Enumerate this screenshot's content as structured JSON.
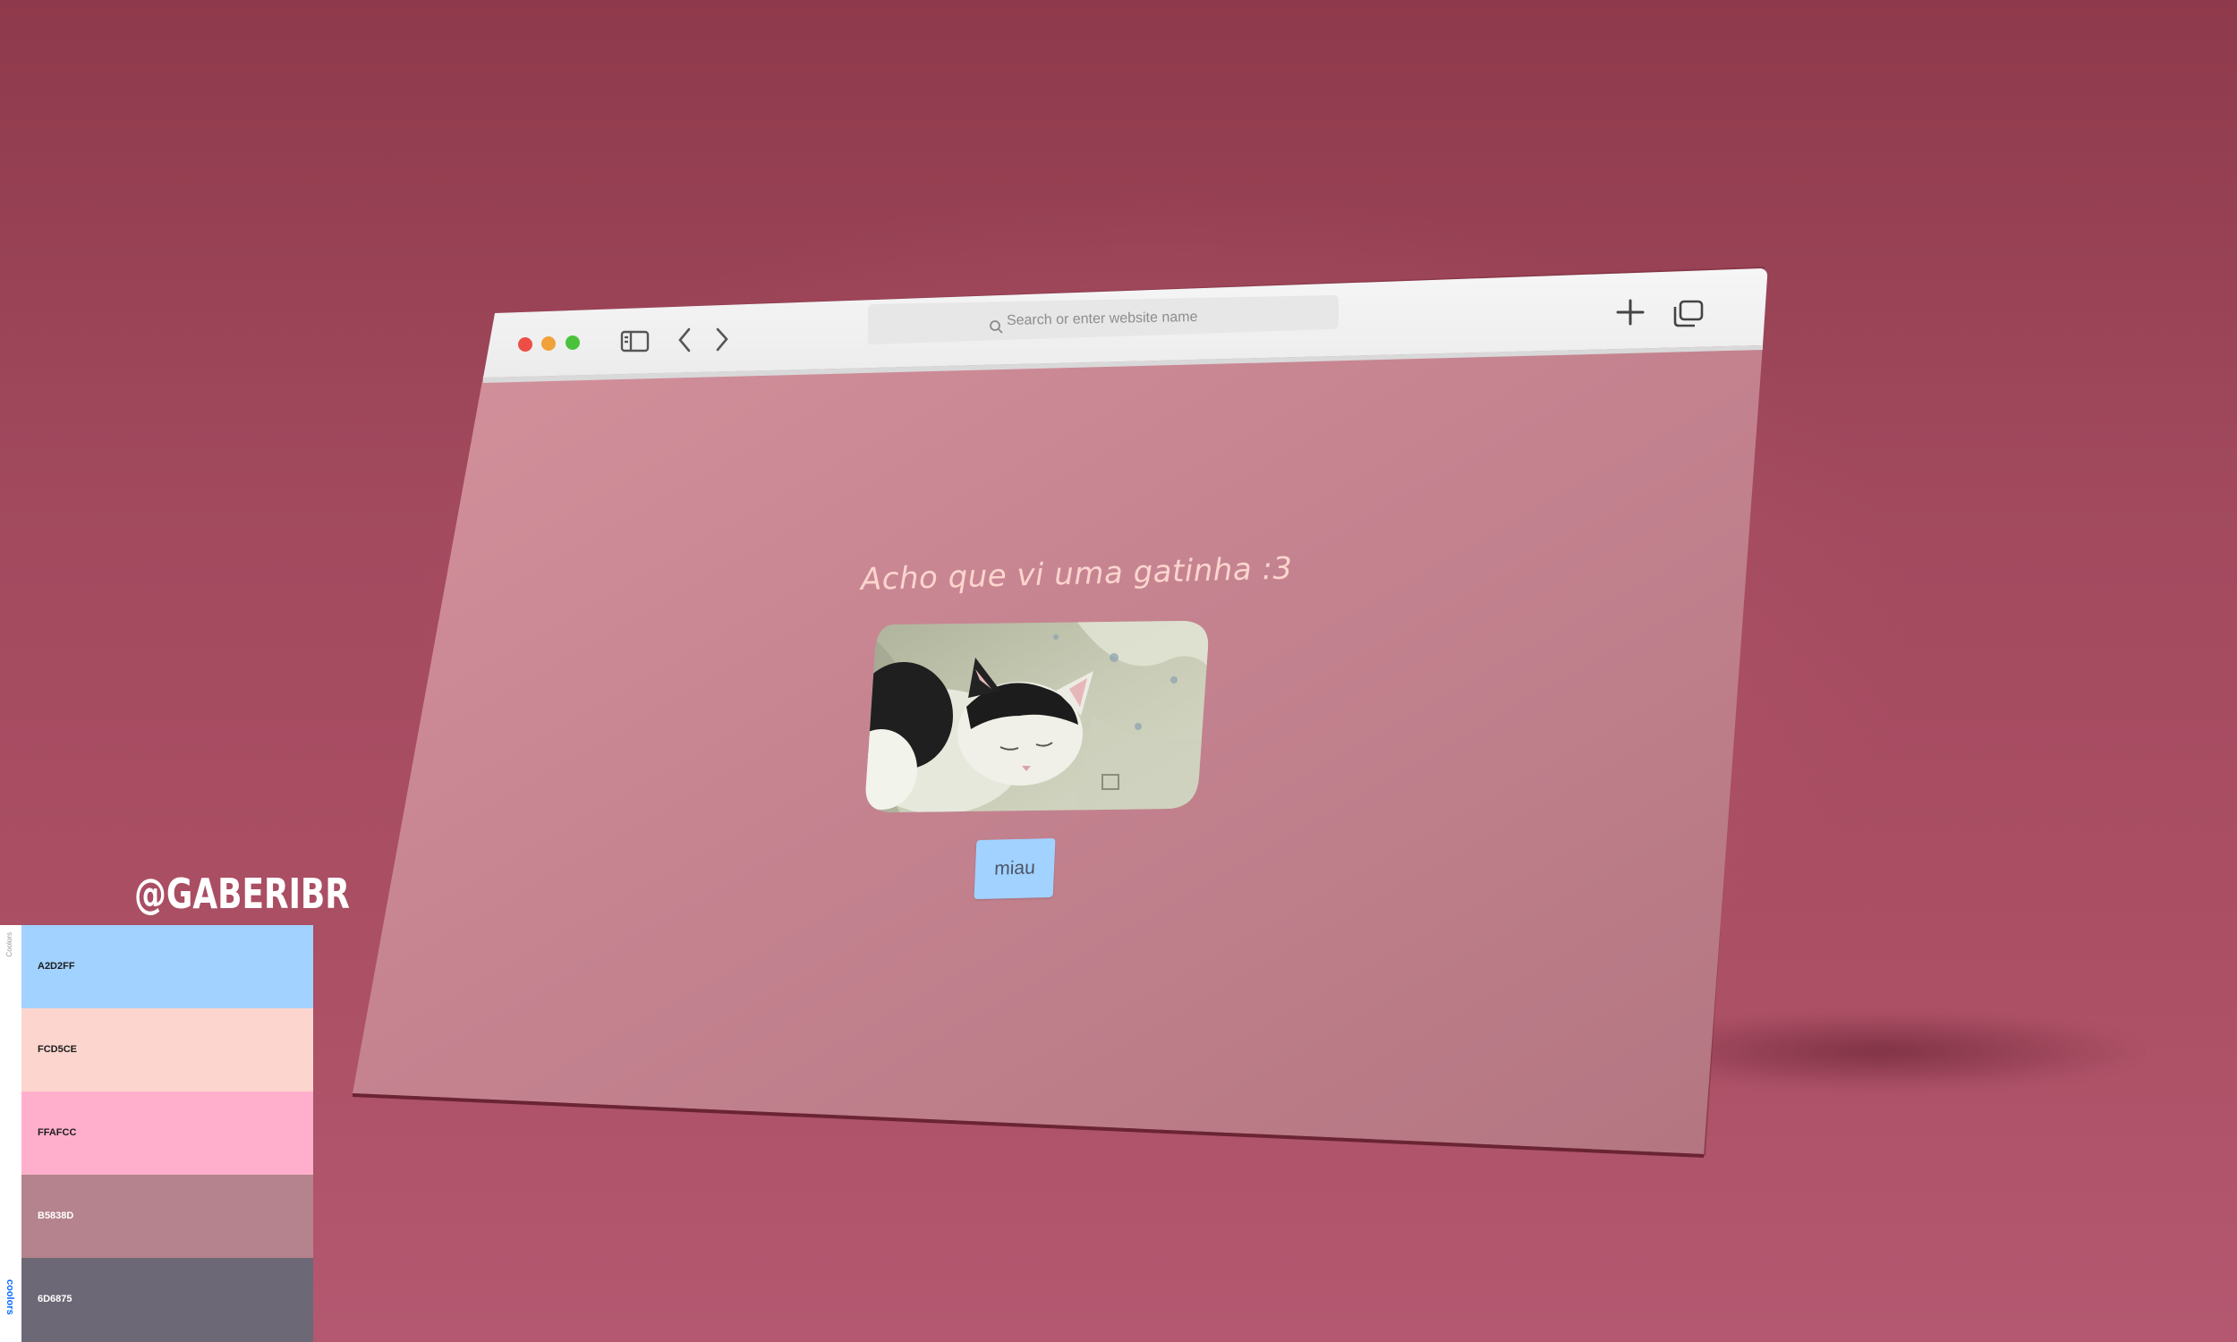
{
  "browser": {
    "search_placeholder": "Search or enter website name",
    "icons": {
      "close": "traffic-light-red",
      "minimize": "traffic-light-yellow",
      "zoom": "traffic-light-green",
      "sidebar": "sidebar-icon",
      "back": "chevron-left-icon",
      "forward": "chevron-right-icon",
      "search": "search-icon",
      "new_tab": "plus-icon",
      "tabs": "tabs-overview-icon"
    }
  },
  "page": {
    "heading": "Acho que vi uma gatinha :3",
    "image": "sleeping-cat-photo",
    "button_label": "miau"
  },
  "watermark": {
    "handle": "@GABERIBR"
  },
  "palette": {
    "brand": "coolors",
    "label": "Coolors",
    "colors": [
      {
        "code": "A2D2FF",
        "hex": "#a2d2ff",
        "text": "#1c1c1c"
      },
      {
        "code": "FCD5CE",
        "hex": "#fcd5ce",
        "text": "#1c1c1c"
      },
      {
        "code": "FFAFCC",
        "hex": "#ffafcc",
        "text": "#1c1c1c"
      },
      {
        "code": "B5838D",
        "hex": "#b5838d",
        "text": "#ffffff"
      },
      {
        "code": "6D6875",
        "hex": "#6d6875",
        "text": "#ffffff"
      }
    ]
  },
  "colors": {
    "background": "#a34a5f",
    "page_background": "#c7838f",
    "toolbar": "#f1f1f1"
  }
}
